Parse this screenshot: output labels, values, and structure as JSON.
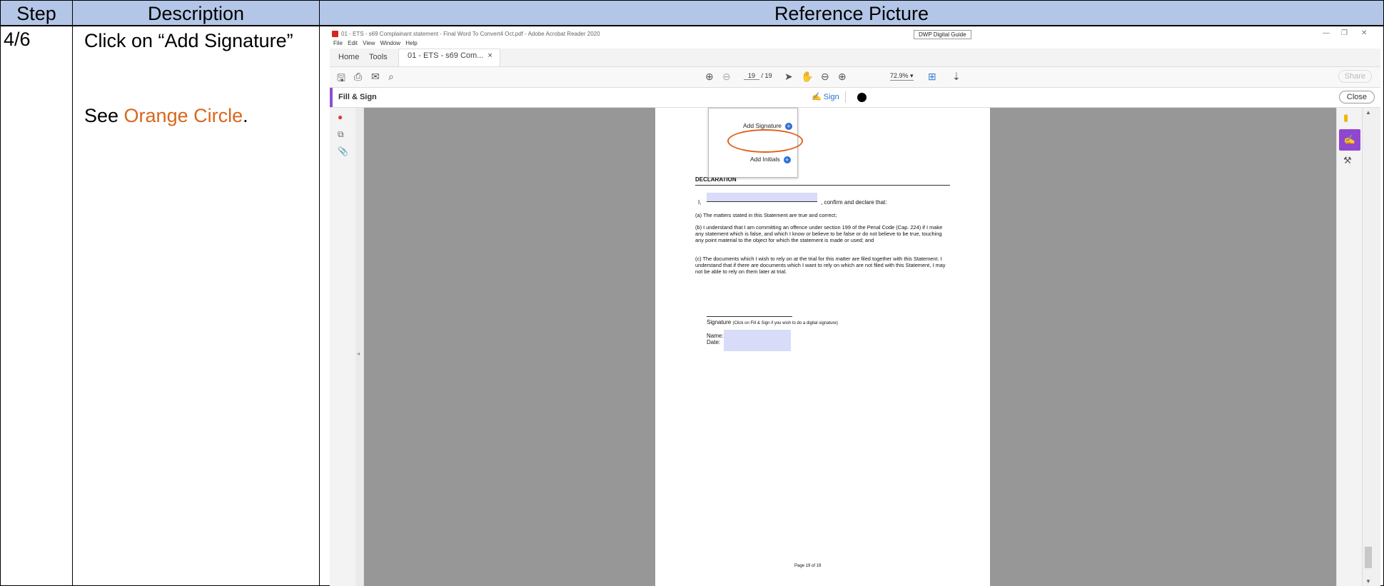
{
  "table": {
    "headers": {
      "step": "Step",
      "description": "Description",
      "reference": "Reference Picture"
    },
    "step": "4/6",
    "description_line1": "Click on “Add Signature”",
    "see_prefix": "See ",
    "see_highlight": "Orange Circle",
    "see_suffix": ".",
    "highlight_color": "#d9661c",
    "header_color": "#b4c6e7"
  },
  "app": {
    "window_title": "01 - ETS - s69 Complainant statement - Final Word To Convert4 Oct.pdf - Adobe Acrobat Reader 2020",
    "guide_button": "DWP Digital Guide",
    "menu": [
      "File",
      "Edit",
      "View",
      "Window",
      "Help"
    ],
    "tabs": {
      "home": "Home",
      "tools": "Tools",
      "doc": "01 - ETS - s69 Com...",
      "close": "×"
    },
    "page_current": "19",
    "page_total": "/ 19",
    "zoom": "72.9%",
    "share": "Share",
    "fill_sign_title": "Fill & Sign",
    "sign_label": "Sign",
    "close_button": "Close",
    "accent_color": "#8f4fd0"
  },
  "dropdown": {
    "add_signature": "Add Signature",
    "add_initials": "Add Initials",
    "circle_color": "#e0621c"
  },
  "document": {
    "declaration": "DECLARATION",
    "i_label": "I,",
    "confirm": ", confirm and declare that:",
    "para_a": "(a) The matters stated in this Statement are true and correct;",
    "para_b": "(b) I understand that I am committing an offence under section 199 of the Penal Code (Cap. 224) if I make any statement which is false, and which I know or believe to be false or do not believe to be true, touching any point material to the object for which the statement is made or used; and",
    "para_c": "(c) The documents which I wish to rely on at the trial for this matter are filed together with this Statement. I understand that if there are documents which I want to rely on which are not filed with this Statement, I may not be able to rely on them later at trial.",
    "signature_label": "Signature",
    "signature_hint": "(Click on Fill & Sign if you wish to do a digital signature)",
    "name_label": "Name:",
    "date_label": "Date:",
    "page_number": "Page 19 of 19"
  }
}
